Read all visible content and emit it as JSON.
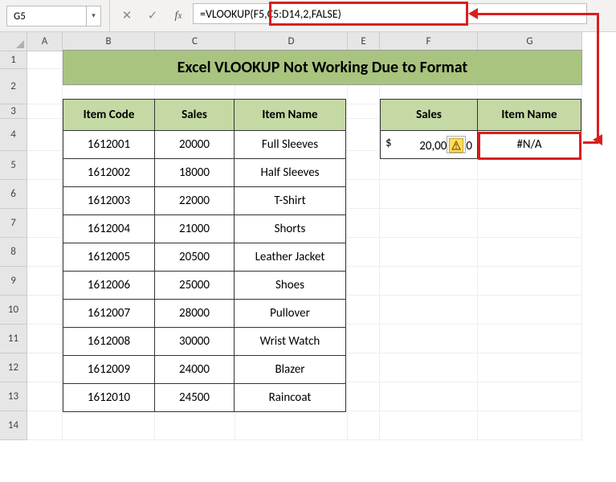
{
  "namebox": {
    "value": "G5"
  },
  "formula_bar": {
    "value": "=VLOOKUP(F5,C5:D14,2,FALSE)"
  },
  "columns": [
    "A",
    "B",
    "C",
    "D",
    "E",
    "F",
    "G"
  ],
  "row_numbers": [
    "1",
    "2",
    "3",
    "4",
    "5",
    "6",
    "7",
    "8",
    "9",
    "10",
    "11",
    "12",
    "13",
    "14"
  ],
  "title": "Excel VLOOKUP Not Working Due to Format",
  "table1": {
    "headers": [
      "Item Code",
      "Sales",
      "Item Name"
    ],
    "rows": [
      [
        "1612001",
        "20000",
        "Full Sleeves"
      ],
      [
        "1612002",
        "18000",
        "Half Sleeves"
      ],
      [
        "1612003",
        "22000",
        "T-Shirt"
      ],
      [
        "1612004",
        "21000",
        "Shorts"
      ],
      [
        "1612005",
        "20500",
        "Leather Jacket"
      ],
      [
        "1612006",
        "25000",
        "Shoes"
      ],
      [
        "1612007",
        "28000",
        "Pullover"
      ],
      [
        "1612008",
        "30000",
        "Wrist Watch"
      ],
      [
        "1612009",
        "24000",
        "Blazer"
      ],
      [
        "1612010",
        "24500",
        "Raincoat"
      ]
    ]
  },
  "table2": {
    "headers": [
      "Sales",
      "Item Name"
    ],
    "f5": {
      "prefix": "$",
      "left": "20,00",
      "right": "0"
    },
    "g5": "#N/A"
  },
  "icons": {
    "dropdown": "▾",
    "cancel": "✕",
    "confirm": "✓"
  }
}
